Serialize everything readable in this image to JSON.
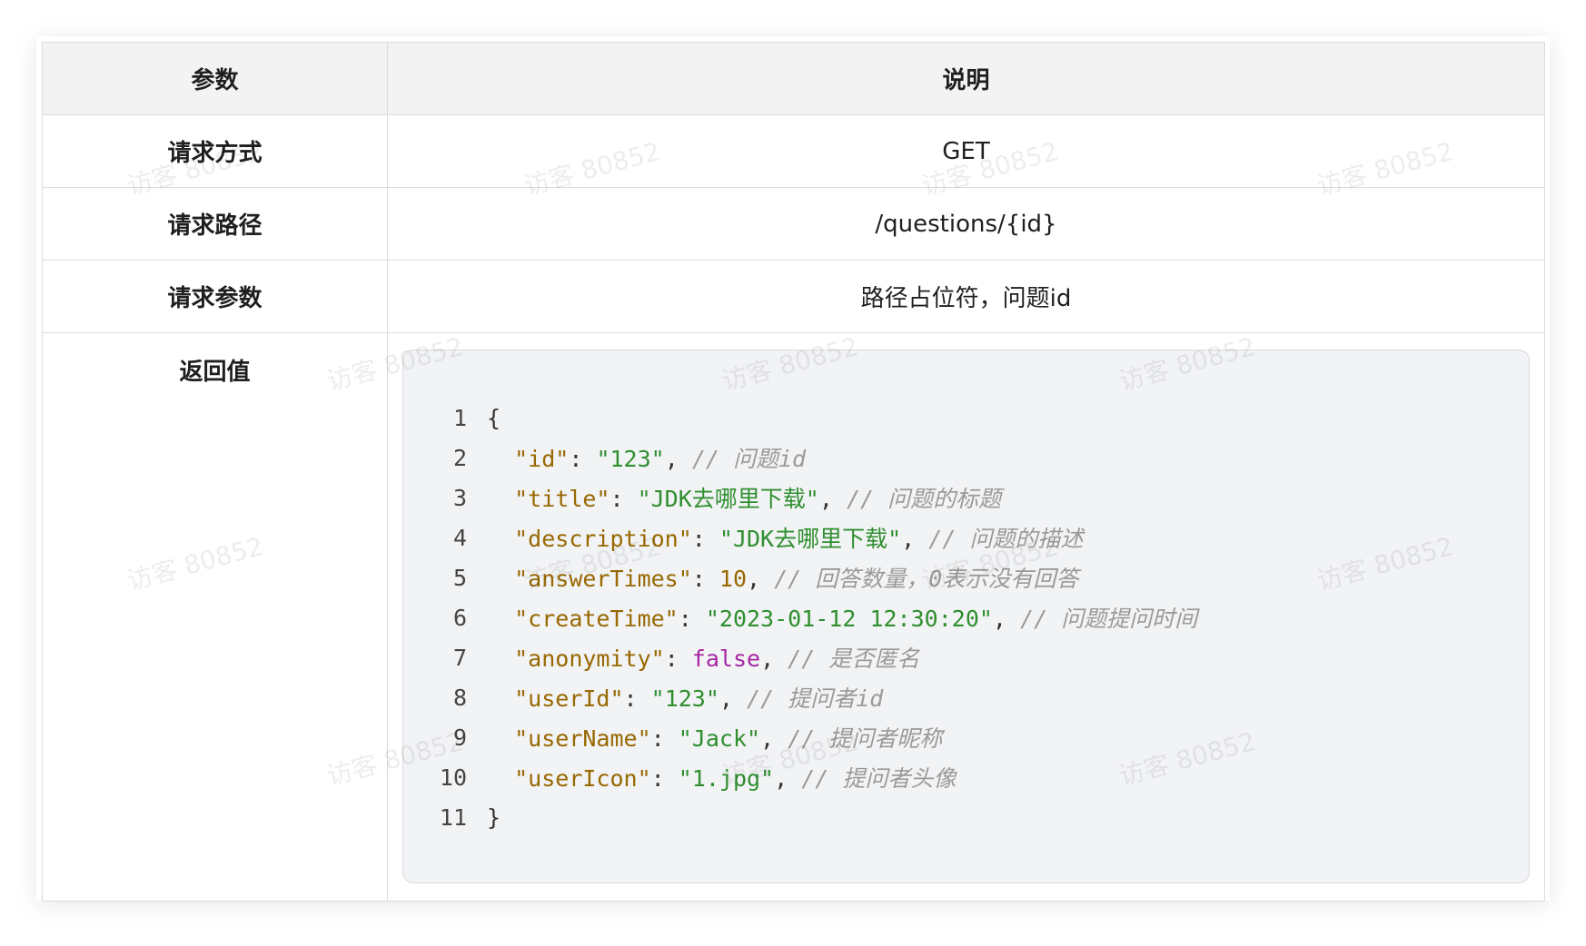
{
  "table": {
    "header": {
      "param": "参数",
      "desc": "说明"
    },
    "rows": [
      {
        "param": "请求方式",
        "value": "GET"
      },
      {
        "param": "请求路径",
        "value": "/questions/{id}"
      },
      {
        "param": "请求参数",
        "value": "路径占位符，问题id"
      }
    ],
    "return_label": "返回值"
  },
  "code": {
    "open_brace": "{",
    "close_brace": "}",
    "lines": [
      {
        "num": "1"
      },
      {
        "num": "2",
        "key": "\"id\"",
        "value": "\"123\"",
        "type": "str",
        "comment": "// 问题id"
      },
      {
        "num": "3",
        "key": "\"title\"",
        "value": "\"JDK去哪里下载\"",
        "type": "str",
        "comment": "// 问题的标题"
      },
      {
        "num": "4",
        "key": "\"description\"",
        "value": "\"JDK去哪里下载\"",
        "type": "str",
        "comment": "// 问题的描述"
      },
      {
        "num": "5",
        "key": "\"answerTimes\"",
        "value": "10",
        "type": "num",
        "comment": "// 回答数量，0表示没有回答"
      },
      {
        "num": "6",
        "key": "\"createTime\"",
        "value": "\"2023-01-12 12:30:20\"",
        "type": "str",
        "comment": "// 问题提问时间"
      },
      {
        "num": "7",
        "key": "\"anonymity\"",
        "value": "false",
        "type": "bool",
        "comment": "// 是否匿名"
      },
      {
        "num": "8",
        "key": "\"userId\"",
        "value": "\"123\"",
        "type": "str",
        "comment": "// 提问者id"
      },
      {
        "num": "9",
        "key": "\"userName\"",
        "value": "\"Jack\"",
        "type": "str",
        "comment": "// 提问者昵称"
      },
      {
        "num": "10",
        "key": "\"userIcon\"",
        "value": "\"1.jpg\"",
        "type": "str",
        "comment": "// 提问者头像"
      },
      {
        "num": "11"
      }
    ]
  },
  "watermark": {
    "text": "访客 80852"
  },
  "colors": {
    "key": "#986801",
    "string": "#2f8f2f",
    "boolean": "#a626a4",
    "comment": "#9a9a9a",
    "header_bg": "#f3f3f3",
    "code_bg": "#f2f3f5"
  }
}
